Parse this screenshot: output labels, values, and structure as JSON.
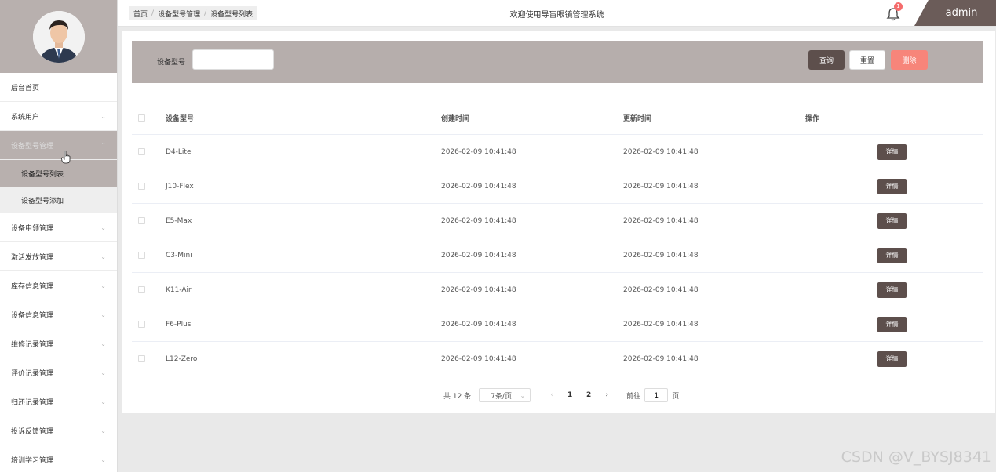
{
  "sidebar": {
    "items": [
      {
        "label": "后台首页",
        "has_chevron": false
      },
      {
        "label": "系统用户",
        "has_chevron": true
      },
      {
        "label": "设备型号管理",
        "has_chevron": true,
        "active": true
      },
      {
        "label": "设备申领管理",
        "has_chevron": true
      },
      {
        "label": "激活发放管理",
        "has_chevron": true
      },
      {
        "label": "库存信息管理",
        "has_chevron": true
      },
      {
        "label": "设备信息管理",
        "has_chevron": true
      },
      {
        "label": "维修记录管理",
        "has_chevron": true
      },
      {
        "label": "评价记录管理",
        "has_chevron": true
      },
      {
        "label": "归还记录管理",
        "has_chevron": true
      },
      {
        "label": "投诉反馈管理",
        "has_chevron": true
      },
      {
        "label": "培训学习管理",
        "has_chevron": true
      }
    ],
    "submenu": [
      {
        "label": "设备型号列表",
        "current": true
      },
      {
        "label": "设备型号添加",
        "current": false
      }
    ],
    "chevron_down": "⌄",
    "chevron_up": "⌃"
  },
  "header": {
    "breadcrumb": [
      "首页",
      "设备型号管理",
      "设备型号列表"
    ],
    "breadcrumb_sep": "/",
    "title": "欢迎使用导盲眼镜管理系统",
    "notification_count": "1",
    "username": "admin"
  },
  "filter": {
    "label": "设备型号",
    "input_value": "",
    "query_label": "查询",
    "reset_label": "重置",
    "delete_label": "删除"
  },
  "table": {
    "columns": [
      "设备型号",
      "创建时间",
      "更新时间",
      "操作"
    ],
    "rows": [
      {
        "model": "D4-Lite",
        "created": "2026-02-09 10:41:48",
        "updated": "2026-02-09 10:41:48",
        "action": "详情"
      },
      {
        "model": "J10-Flex",
        "created": "2026-02-09 10:41:48",
        "updated": "2026-02-09 10:41:48",
        "action": "详情"
      },
      {
        "model": "E5-Max",
        "created": "2026-02-09 10:41:48",
        "updated": "2026-02-09 10:41:48",
        "action": "详情"
      },
      {
        "model": "C3-Mini",
        "created": "2026-02-09 10:41:48",
        "updated": "2026-02-09 10:41:48",
        "action": "详情"
      },
      {
        "model": "K11-Air",
        "created": "2026-02-09 10:41:48",
        "updated": "2026-02-09 10:41:48",
        "action": "详情"
      },
      {
        "model": "F6-Plus",
        "created": "2026-02-09 10:41:48",
        "updated": "2026-02-09 10:41:48",
        "action": "详情"
      },
      {
        "model": "L12-Zero",
        "created": "2026-02-09 10:41:48",
        "updated": "2026-02-09 10:41:48",
        "action": "详情"
      }
    ]
  },
  "pagination": {
    "total": "共 12 条",
    "page_size": "7条/页",
    "prev": "‹",
    "next": "›",
    "pages": [
      "1",
      "2"
    ],
    "goto_label": "前往",
    "goto_value": "1",
    "page_suffix": "页"
  },
  "watermark": "CSDN @V_BYSJ8341",
  "colors": {
    "accent_dark": "#5d4f4c",
    "accent_light": "#b6aeac",
    "danger": "#f7857a",
    "badge": "#f56c6c"
  }
}
